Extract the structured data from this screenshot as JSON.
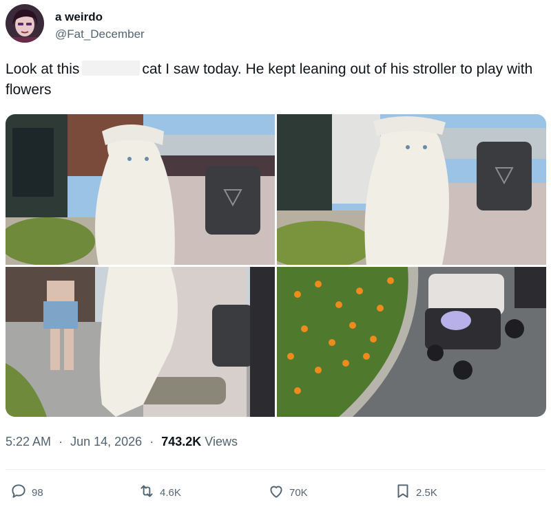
{
  "author": {
    "display_name": "a weirdo",
    "handle": "@Fat_December"
  },
  "tweet": {
    "text_before": "Look at this",
    "text_after": "cat I saw today. He kept leaning out of his stroller to play with flowers"
  },
  "media": {
    "photos": [
      {
        "description": "white cat in hat leaning out of stroller"
      },
      {
        "description": "white cat in hat in stroller, closer"
      },
      {
        "description": "cat reaching out of stroller on street"
      },
      {
        "description": "orange flowers beside stroller"
      }
    ]
  },
  "meta": {
    "time": "5:22 AM",
    "separator": "·",
    "date": "Jun 14, 2026",
    "views_count": "743.2K",
    "views_label": "Views"
  },
  "actions": {
    "reply_count": "98",
    "retweet_count": "4.6K",
    "like_count": "70K",
    "bookmark_count": "2.5K"
  },
  "colors": {
    "text_primary": "#0f1419",
    "text_secondary": "#536471",
    "divider": "#eff3f4"
  }
}
